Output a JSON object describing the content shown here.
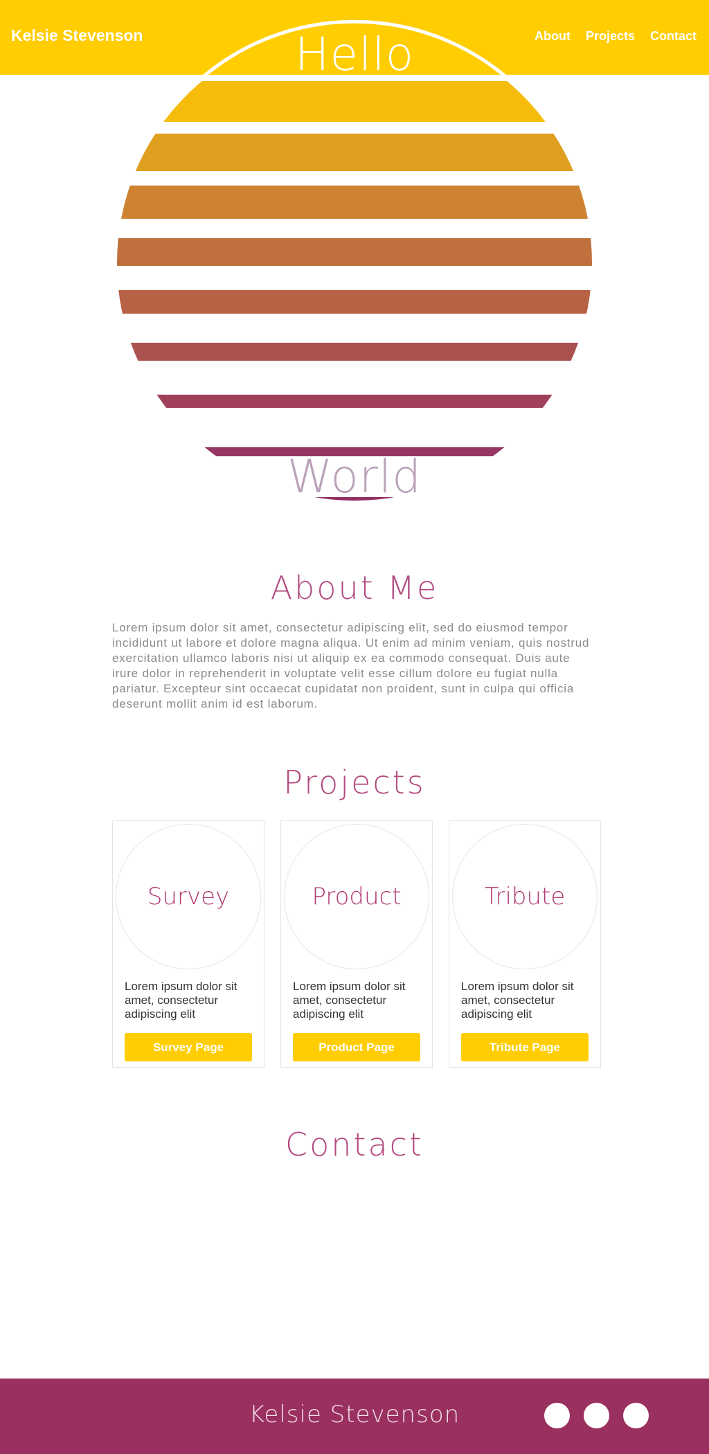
{
  "header": {
    "brand": "Kelsie Stevenson",
    "nav": [
      "About",
      "Projects",
      "Contact"
    ]
  },
  "hero": {
    "top_word": "Hello",
    "bottom_word": "World"
  },
  "about": {
    "title": "About Me",
    "text": "Lorem ipsum dolor sit amet, consectetur adipiscing elit, sed do eiusmod tempor incididunt ut labore et dolore magna aliqua. Ut enim ad minim veniam, quis nostrud exercitation ullamco laboris nisi ut aliquip ex ea commodo consequat. Duis aute irure dolor in reprehenderit in voluptate velit esse cillum dolore eu fugiat nulla pariatur. Excepteur sint occaecat cupidatat non proident, sunt in culpa qui officia deserunt mollit anim id est laborum."
  },
  "projects": {
    "title": "Projects",
    "cards": [
      {
        "name": "Survey",
        "text": "Lorem ipsum dolor sit amet, consectetur adipiscing elit",
        "button": "Survey Page"
      },
      {
        "name": "Product",
        "text": "Lorem ipsum dolor sit amet, consectetur adipiscing elit",
        "button": "Product Page"
      },
      {
        "name": "Tribute",
        "text": "Lorem ipsum dolor sit amet, consectetur adipiscing elit",
        "button": "Tribute Page"
      }
    ]
  },
  "contact": {
    "title": "Contact"
  },
  "footer": {
    "name": "Kelsie Stevenson",
    "social_icons": [
      "social-icon-1",
      "social-icon-2",
      "social-icon-3"
    ]
  },
  "colors": {
    "accent_yellow": "#ffcd00",
    "footer_plum": "#9a3060",
    "title_pink": "#b24a7f",
    "sun_stripes": [
      "#f5bc0c",
      "#e09f1f",
      "#cd8331",
      "#c0703d",
      "#b76145",
      "#ab514f",
      "#a0405a",
      "#963563",
      "#922f63"
    ]
  }
}
